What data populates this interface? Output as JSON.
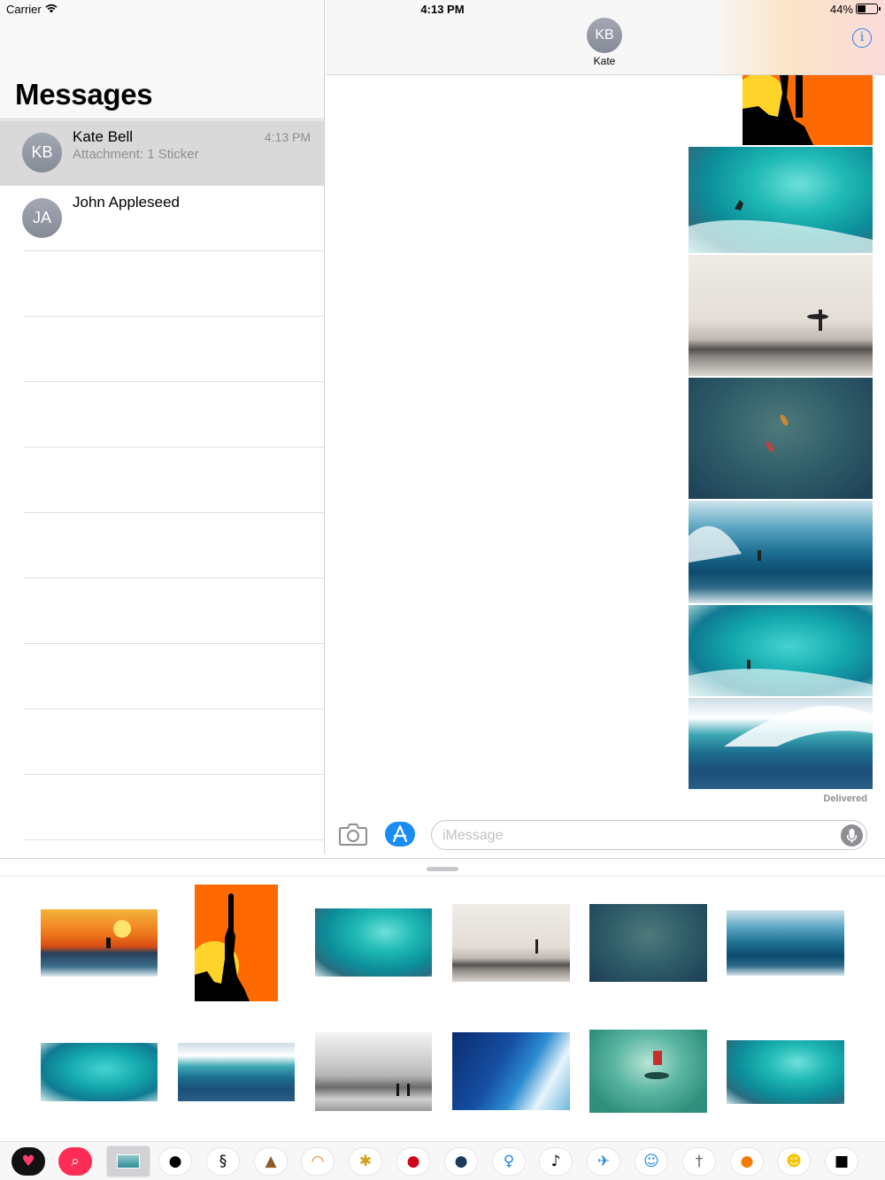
{
  "status_bar": {
    "carrier": "Carrier",
    "time": "4:13 PM",
    "battery_text": "44%",
    "battery_level": 0.44
  },
  "sidebar": {
    "title": "Messages",
    "conversations": [
      {
        "initials": "KB",
        "name": "Kate Bell",
        "preview": "Attachment: 1 Sticker",
        "time": "4:13 PM",
        "selected": true
      },
      {
        "initials": "JA",
        "name": "John Appleseed",
        "preview": "",
        "time": "",
        "selected": false
      }
    ]
  },
  "conversation": {
    "contact_initials": "KB",
    "contact_name": "Kate",
    "delivered_label": "Delivered",
    "messages": [
      {
        "photo": "sunset-silhouette-surfer"
      },
      {
        "photo": "turquoise-wave-surfer"
      },
      {
        "photo": "misty-beach-surfer"
      },
      {
        "photo": "aerial-surfers"
      },
      {
        "photo": "barrel-wave-surfer"
      },
      {
        "photo": "turquoise-wave-surfer-2"
      },
      {
        "photo": "big-wave-surfer"
      }
    ]
  },
  "compose": {
    "placeholder": "iMessage",
    "value": ""
  },
  "sticker_browser": {
    "stickers": [
      {
        "photo": "sunset-surfer"
      },
      {
        "photo": "orange-silhouette-surfer"
      },
      {
        "photo": "turquoise-wave-surfer"
      },
      {
        "photo": "misty-beach-surfer"
      },
      {
        "photo": "aerial-surfers"
      },
      {
        "photo": "barrel-wave"
      },
      {
        "photo": "turquoise-wave-surfer-2"
      },
      {
        "photo": "big-wave"
      },
      {
        "photo": "black-white-beach-surfers"
      },
      {
        "photo": "deep-blue-wave-surfer"
      },
      {
        "photo": "green-wave-surfer"
      },
      {
        "photo": "turquoise-barrel-surfer"
      }
    ],
    "app_strip": [
      "heart-sticker-app-icon",
      "search-images-app-icon",
      "surf-stickers-app-icon",
      "hat-app-icon",
      "fingerprint-app-icon",
      "cake-app-icon",
      "rainbow-app-icon",
      "bee-app-icon",
      "ladybug-app-icon",
      "globe-app-icon",
      "balloon-app-icon",
      "treble-clef-app-icon",
      "runner-app-icon",
      "figure-app-icon",
      "golfer-app-icon",
      "pumpkin-app-icon",
      "smiley-app-icon",
      "pig-app-icon"
    ]
  },
  "colors": {
    "accent": "#007aff",
    "selected_row": "#d9d9d9",
    "avatar": "#9ea3ad"
  }
}
